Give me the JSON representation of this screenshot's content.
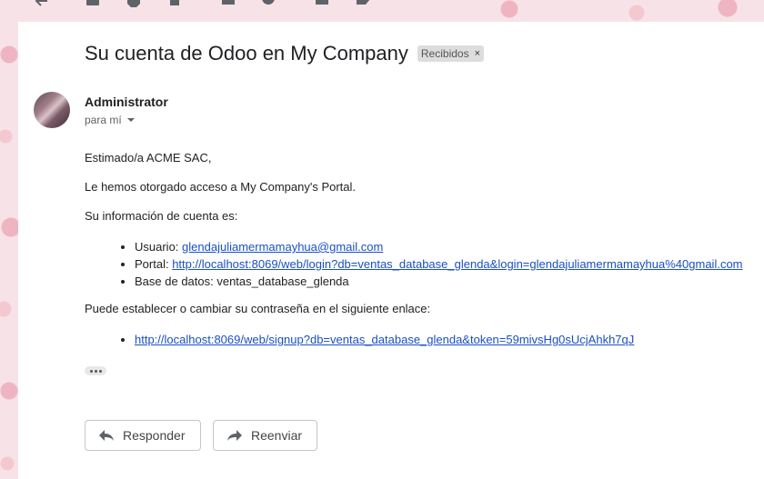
{
  "colors": {
    "link": "#1a4fc4",
    "chip_bg": "#dddddd",
    "panel": "#ffffff"
  },
  "email": {
    "subject": "Su cuenta de Odoo en My Company",
    "label": "Recibidos",
    "label_close": "×",
    "sender": "Administrator",
    "to": "para mí",
    "greeting": "Estimado/a ACME SAC,",
    "intro": "Le hemos otorgado acceso a My Company's Portal.",
    "account_heading": "Su información de cuenta es:",
    "account_items": [
      {
        "label": "Usuario: ",
        "link": "glendajuliamermamayhua@gmail.com"
      },
      {
        "label": "Portal: ",
        "link": "http://localhost:8069/web/login?db=ventas_database_glenda&login=glendajuliamermamayhua%40gmail.com"
      },
      {
        "label": "Base de datos: ventas_database_glenda"
      }
    ],
    "password_heading": "Puede establecer o cambiar su contraseña en el siguiente enlace:",
    "signup_link": "http://localhost:8069/web/signup?db=ventas_database_glenda&token=59mivsHg0sUcjAhkh7qJ"
  },
  "actions": {
    "reply": "Responder",
    "forward": "Reenviar"
  },
  "icons": [
    "back-arrow-icon",
    "archive-icon",
    "report-spam-icon",
    "delete-icon",
    "mark-unread-icon",
    "snooze-icon",
    "move-to-icon",
    "label-icon",
    "more-vert-icon",
    "reply-icon",
    "forward-icon"
  ]
}
